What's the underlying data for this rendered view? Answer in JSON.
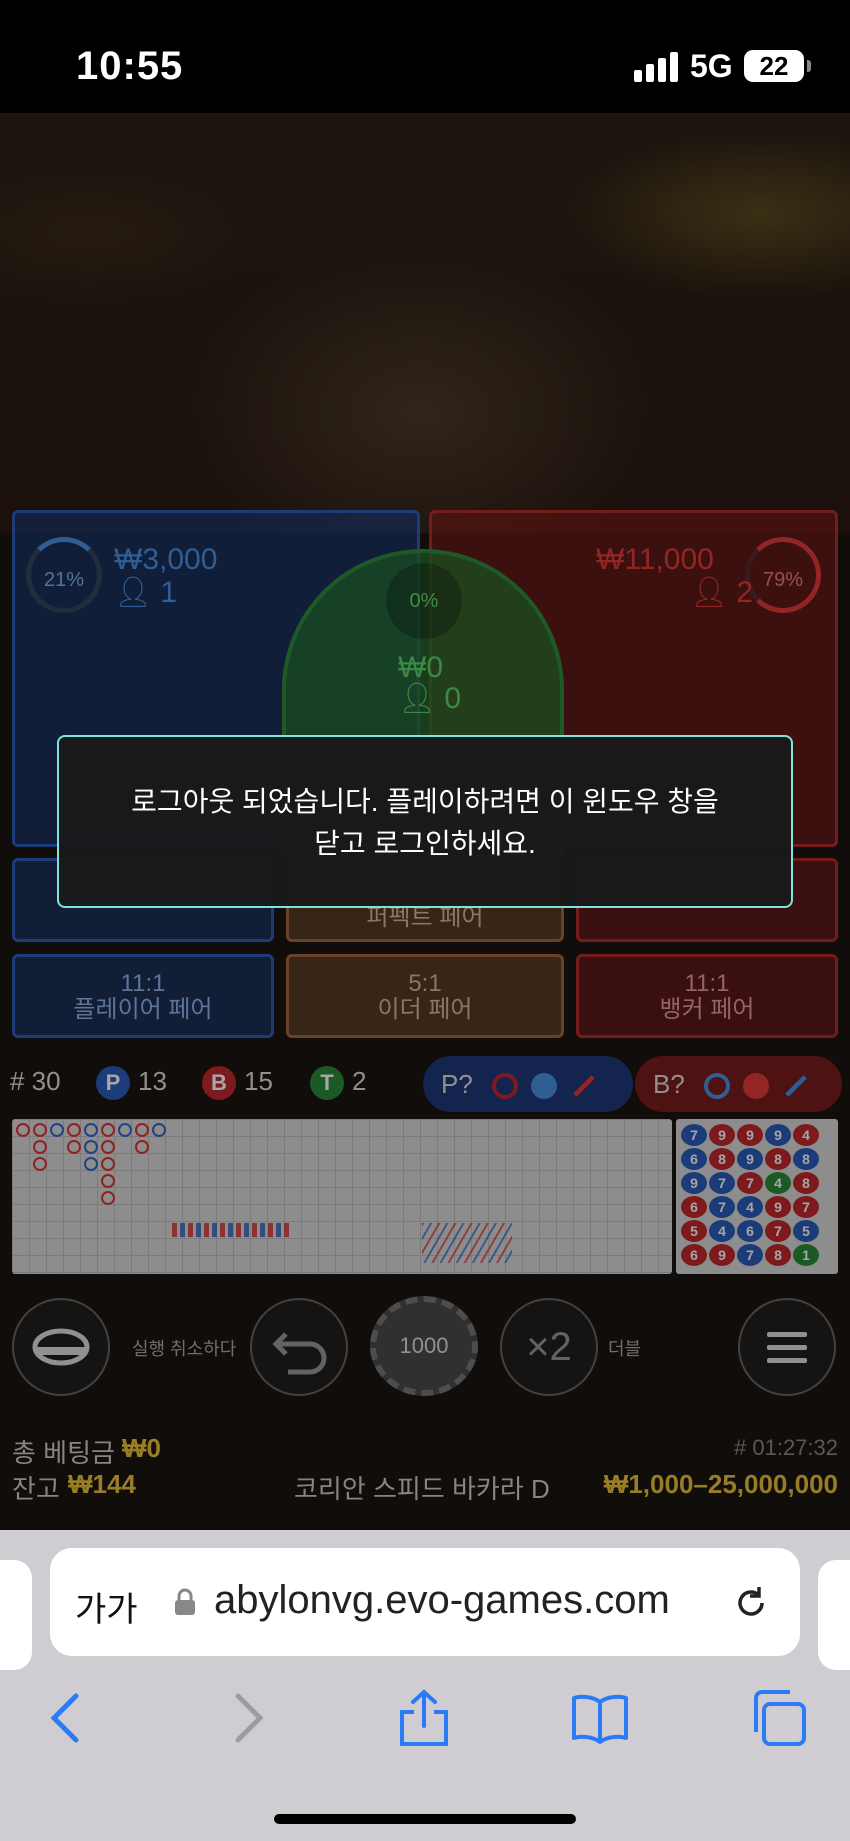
{
  "status": {
    "time": "10:55",
    "network": "5G",
    "battery": "22"
  },
  "bets": {
    "player": {
      "percent": "21%",
      "amount": "₩3,000",
      "players": "1",
      "color": "#4a90e2"
    },
    "banker": {
      "percent": "79%",
      "amount": "₩11,000",
      "players": "2",
      "color": "#e23a3a"
    },
    "tie": {
      "percent": "0%",
      "amount": "₩0",
      "players": "0",
      "color": "#5fd16a"
    }
  },
  "side_bets": {
    "perfect_pair": "퍼펙트 페어",
    "player_pair": {
      "odds": "11:1",
      "label": "플레이어 페어"
    },
    "either_pair": {
      "odds": "5:1",
      "label": "이더 페어"
    },
    "banker_pair": {
      "odds": "11:1",
      "label": "뱅커 페어"
    }
  },
  "stats": {
    "round": "# 30",
    "player_letter": "P",
    "player_count": "13",
    "banker_letter": "B",
    "banker_count": "15",
    "tie_letter": "T",
    "tie_count": "2",
    "player_predict": "P?",
    "banker_predict": "B?"
  },
  "bead_plate": [
    [
      "7",
      "9",
      "9",
      "9",
      "4"
    ],
    [
      "6",
      "8",
      "9",
      "8",
      "8"
    ],
    [
      "9",
      "7",
      "7",
      "4",
      "8"
    ],
    [
      "6",
      "7",
      "4",
      "9",
      "7"
    ],
    [
      "5",
      "4",
      "6",
      "7",
      "5"
    ],
    [
      "6",
      "9",
      "7",
      "8",
      "1"
    ]
  ],
  "bead_colors": [
    [
      "B",
      "R",
      "R",
      "B",
      "R"
    ],
    [
      "B",
      "R",
      "B",
      "R",
      "B"
    ],
    [
      "B",
      "B",
      "R",
      "G",
      "R"
    ],
    [
      "R",
      "B",
      "B",
      "R",
      "R"
    ],
    [
      "R",
      "B",
      "B",
      "R",
      "B"
    ],
    [
      "R",
      "R",
      "B",
      "R",
      "G"
    ]
  ],
  "controls": {
    "undo_label": "실행 취소하다",
    "chip_value": "1000",
    "double_symbol": "×2",
    "double_label": "더블"
  },
  "footer": {
    "total_bet_label": "총 베팅금",
    "total_bet_value": "₩0",
    "balance_label": "잔고",
    "balance_value": "₩144",
    "round_time": "# 01:27:32",
    "table_name": "코리안 스피드 바카라 D",
    "limits": "₩1,000–25,000,000"
  },
  "modal": {
    "message_line1": "로그아웃 되었습니다. 플레이하려면 이 윈도우 창을",
    "message_line2": "닫고 로그인하세요."
  },
  "browser": {
    "text_size_button": "가가",
    "url": "abylonvg.evo-games.com"
  }
}
